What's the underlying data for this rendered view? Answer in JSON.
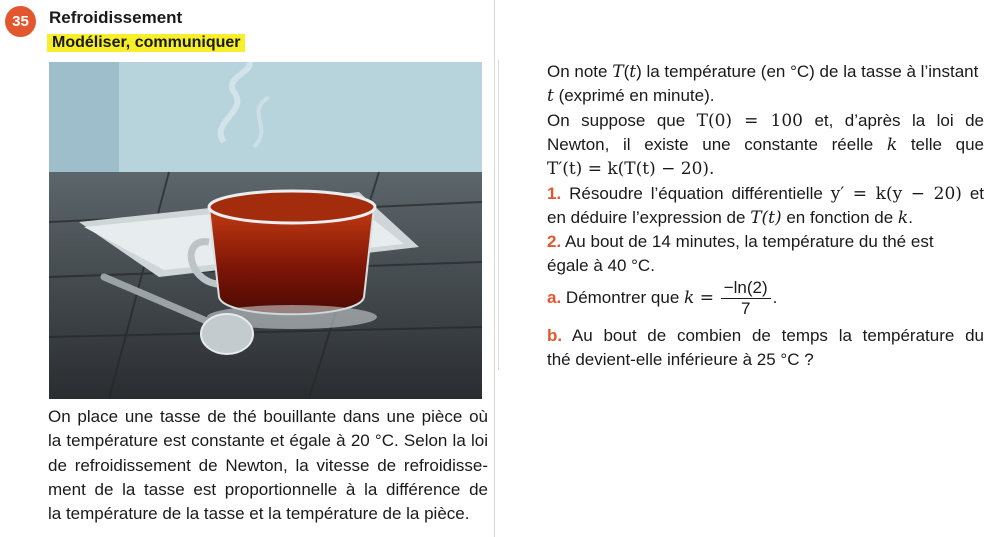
{
  "exercise": {
    "number": "35",
    "title": "Refroidissement",
    "skill": "Modéliser, communiquer"
  },
  "intro_lines": [
    "On place une tasse de thé bouillante dans une pièce où",
    "la température est constante et égale à 20 °C. Selon la loi",
    "de refroidissement de Newton, la vitesse de refroidisse-",
    "ment de la tasse est proportionnelle à la différence de",
    "la température de la tasse et la température de la pièce."
  ],
  "right": {
    "p1a": "On note ",
    "p1_T": "T",
    "p1_t": "t",
    "p1b": " la température (en °C) de la tasse à l’instant",
    "p1c": " (exprimé en minute).",
    "p2a": "On suppose que ",
    "p2_eq": "T(0) = 100",
    "p2b": " et, d’après la loi de",
    "p3a": "Newton, il existe une constante réelle ",
    "k": "k",
    "p3b": " telle que",
    "p4_eq": "T′(t) = k(T(t) − 20).",
    "q1_num": "1.",
    "q1a": " Résoudre l’équation différentielle ",
    "q1_eq": "y′ = k(y − 20)",
    "q1b": " et",
    "q1c": "en déduire l’expression de ",
    "q1_Tt": "T(t)",
    "q1d": " en fonction de ",
    "q1e": ".",
    "q2_num": "2.",
    "q2a": " Au bout de 14 minutes, la température du thé est",
    "q2b": "égale à 40 °C.",
    "qa_num": "a.",
    "qa_text": " Démontrer que ",
    "qa_eq": "k =",
    "qa_frac_top": "−ln(2)",
    "qa_frac_bot": "7",
    "qa_end": ".",
    "qb_num": "b.",
    "qb_a": " Au bout de combien de temps la température du",
    "qb_b": "thé devient-elle inférieure à 25 °C ?"
  },
  "colors": {
    "badge": "#e4572e",
    "highlight": "#f6ef2a",
    "question_number": "#e4572e"
  }
}
